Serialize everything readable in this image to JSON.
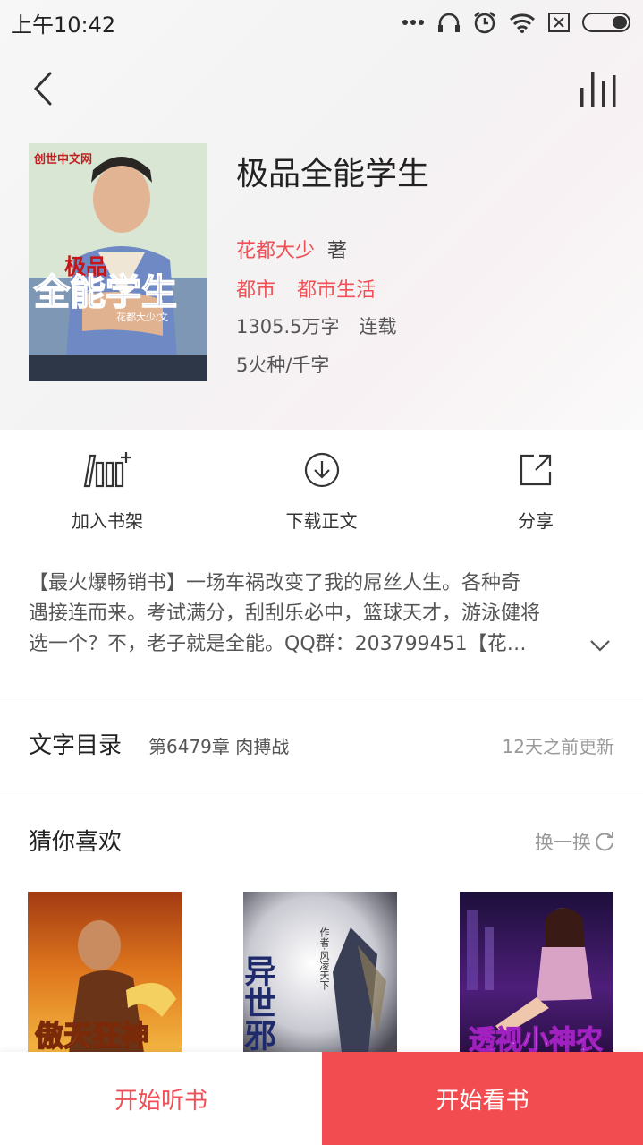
{
  "status_bar": {
    "time": "上午10:42",
    "icons": [
      "more-dots-icon",
      "headphone-icon",
      "alarm-icon",
      "wifi-icon",
      "sim-icon",
      "battery-icon"
    ]
  },
  "header": {
    "back_icon": "chevron-left-icon",
    "chart_icon": "bar-chart-icon"
  },
  "book": {
    "title": "极品全能学生",
    "author": "花都大少",
    "author_suffix": "著",
    "tags": [
      "都市",
      "都市生活"
    ],
    "word_count": "1305.5万字",
    "status": "连载",
    "price": "5火种/千字",
    "cover": {
      "publisher": "创世中文网",
      "title_small": "极品",
      "title_big": "全能学生",
      "byline": "花都大少/文"
    }
  },
  "actions": [
    {
      "label": "加入书架",
      "icon": "add-bookshelf-icon"
    },
    {
      "label": "下载正文",
      "icon": "download-icon"
    },
    {
      "label": "分享",
      "icon": "share-icon"
    }
  ],
  "description": {
    "line1": "【最火爆畅销书】一场车祸改变了我的屌丝人生。各种奇",
    "line2": "遇接连而来。考试满分，刮刮乐必中，篮球天才，游泳健将",
    "line3": "选一个？不，老子就是全能。QQ群：203799451【花…"
  },
  "toc": {
    "title": "文字目录",
    "latest_chapter": "第6479章 肉搏战",
    "updated": "12天之前更新"
  },
  "recommend": {
    "title": "猜你喜欢",
    "refresh_label": "换一换",
    "books": [
      {
        "cover_text": "傲天狂神"
      },
      {
        "cover_text": "异世邪君",
        "cover_author": "作者·风凌天下"
      },
      {
        "cover_text": "透视小神农"
      }
    ]
  },
  "bottom": {
    "listen_label": "开始听书",
    "read_label": "开始看书"
  },
  "colors": {
    "accent": "#f05055",
    "read_button": "#f24c50"
  }
}
